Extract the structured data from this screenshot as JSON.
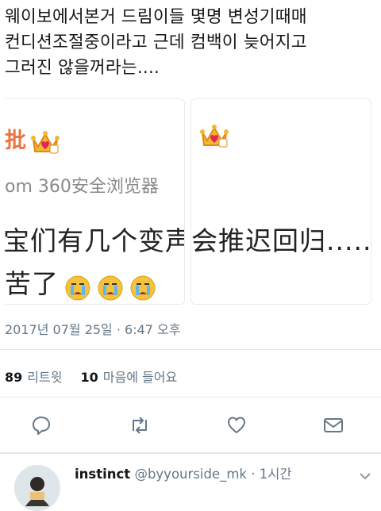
{
  "tweet": {
    "text": "웨이보에서본거 드림이들 몇명 변성기때매\n컨디션조절중이라고 근데 컴백이 늦어지고\n그러진 않을꺼라는....",
    "timestamp": "2017년 07월 25일 · 6:47 오후"
  },
  "media_left": {
    "name": "批",
    "source": "om 360安全浏览器",
    "line1": "宝们有几个变声",
    "line2": "苦了"
  },
  "media_right": {
    "line1": "会推迟回归....."
  },
  "stats": {
    "retweets_count": "89",
    "retweets_label": "리트윗",
    "likes_count": "10",
    "likes_label": "마음에 들어요"
  },
  "actions": [
    {
      "icon": "reply-icon"
    },
    {
      "icon": "retweet-icon"
    },
    {
      "icon": "heart-icon"
    },
    {
      "icon": "message-icon"
    }
  ],
  "reply": {
    "name": "instinct",
    "handle": "@byyourside_mk · 1시간"
  },
  "colors": {
    "icon": "#657786",
    "divider": "#e1e8ed",
    "weibo_name": "#eb7340"
  }
}
